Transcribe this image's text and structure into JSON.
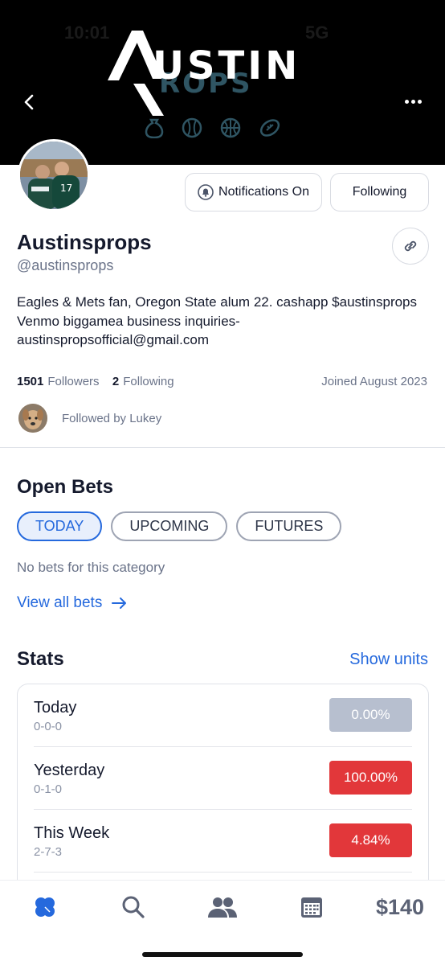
{
  "header": {
    "status_time": "10:01",
    "status_right": "5G",
    "logo_text_main": "USTIN",
    "logo_text_sub": "ROPS",
    "back_icon": "chevron-left-icon",
    "more_icon": "more-horizontal-icon"
  },
  "profile": {
    "notify_label": "Notifications On",
    "following_button_label": "Following",
    "display_name": "Austinsprops",
    "handle": "@austinsprops",
    "bio": "Eagles & Mets fan, Oregon State alum 22. cashapp $austinsprops Venmo biggamea business inquiries- austinspropsofficial@gmail.com",
    "followers_count": "1501",
    "followers_label": "Followers",
    "following_count": "2",
    "following_label": "Following",
    "joined": "Joined August 2023",
    "followed_by": "Followed by Lukey"
  },
  "open_bets": {
    "title": "Open Bets",
    "tabs": [
      {
        "label": "TODAY",
        "active": true
      },
      {
        "label": "UPCOMING",
        "active": false
      },
      {
        "label": "FUTURES",
        "active": false
      }
    ],
    "empty_text": "No bets for this category",
    "view_all_label": "View all bets"
  },
  "stats": {
    "title": "Stats",
    "show_units_label": "Show units",
    "rows": [
      {
        "label": "Today",
        "record": "0-0-0",
        "value": "0.00%",
        "color": "#b7bfcf"
      },
      {
        "label": "Yesterday",
        "record": "0-1-0",
        "value": "100.00%",
        "color": "#e2373a"
      },
      {
        "label": "This Week",
        "record": "2-7-3",
        "value": "4.84%",
        "color": "#e2373a"
      }
    ]
  },
  "nav": {
    "items": [
      "clover-icon",
      "search-icon",
      "people-icon",
      "calendar-icon"
    ],
    "balance": "$140"
  },
  "colors": {
    "accent": "#2569dd",
    "negative": "#e2373a",
    "neutral": "#b7bfcf"
  }
}
